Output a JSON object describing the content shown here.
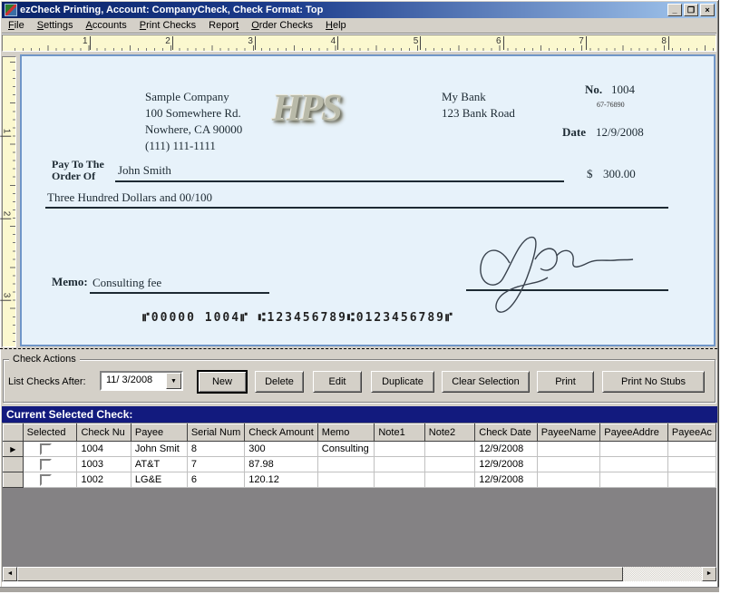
{
  "window": {
    "title": "ezCheck Printing, Account: CompanyCheck, Check Format: Top",
    "controls": {
      "minimize": "_",
      "restore": "❐",
      "close": "×"
    }
  },
  "menu": {
    "items": [
      {
        "label": "File",
        "u": 0
      },
      {
        "label": "Settings",
        "u": 0
      },
      {
        "label": "Accounts",
        "u": 0
      },
      {
        "label": "Print Checks",
        "u": 0
      },
      {
        "label": "Report",
        "u": 5
      },
      {
        "label": "Order Checks",
        "u": 0
      },
      {
        "label": "Help",
        "u": 0
      }
    ]
  },
  "rulers": {
    "horizontal": [
      "1",
      "2",
      "3",
      "4",
      "5",
      "6",
      "7",
      "8"
    ],
    "vertical": [
      "1",
      "2",
      "3"
    ]
  },
  "check": {
    "company": {
      "lines": "Sample Company\n100 Somewhere Rd.\nNowhere, CA 90000\n(111) 111-1111"
    },
    "logo": "HPS",
    "bank": {
      "lines": "My Bank\n123 Bank Road"
    },
    "number": {
      "label": "No.",
      "value": "1004"
    },
    "fraction": "67-76890",
    "date": {
      "label": "Date",
      "value": "12/9/2008"
    },
    "pay_to": {
      "label": "Pay To The\nOrder Of",
      "payee": "John Smith"
    },
    "amount": {
      "symbol": "$",
      "value": "300.00"
    },
    "amount_words": "Three Hundred  Dollars and 00/100",
    "memo": {
      "label": "Memo:",
      "value": "Consulting fee"
    },
    "micr": "⑈00000 1004⑈ ⑆123456789⑆0123456789⑈"
  },
  "check_actions": {
    "group_label": "Check Actions",
    "list_label": "List Checks After:",
    "date_filter": "11/ 3/2008",
    "dropdown_arrow": "▼",
    "buttons": [
      "New",
      "Delete",
      "Edit",
      "Duplicate",
      "Clear Selection",
      "Print",
      "Print No Stubs"
    ]
  },
  "grid": {
    "banner": "Current Selected Check:",
    "columns": [
      "Selected",
      "Check Nu",
      "Payee",
      "Serial Num",
      "Check Amount",
      "Memo",
      "Note1",
      "Note2",
      "Check Date",
      "PayeeName",
      "PayeeAddre",
      "PayeeAc"
    ],
    "rows": [
      {
        "current": true,
        "selected": false,
        "values": [
          "1004",
          "John Smit",
          "8",
          "300",
          "Consulting",
          "",
          "",
          "12/9/2008",
          "",
          "",
          ""
        ]
      },
      {
        "current": false,
        "selected": false,
        "values": [
          "1003",
          "AT&T",
          "7",
          "87.98",
          "",
          "",
          "",
          "12/9/2008",
          "",
          "",
          ""
        ]
      },
      {
        "current": false,
        "selected": false,
        "values": [
          "1002",
          "LG&E",
          "6",
          "120.12",
          "",
          "",
          "",
          "12/9/2008",
          "",
          "",
          ""
        ]
      }
    ],
    "current_row_marker": "▶",
    "scroll": {
      "left_arrow": "◄",
      "right_arrow": "►"
    }
  }
}
